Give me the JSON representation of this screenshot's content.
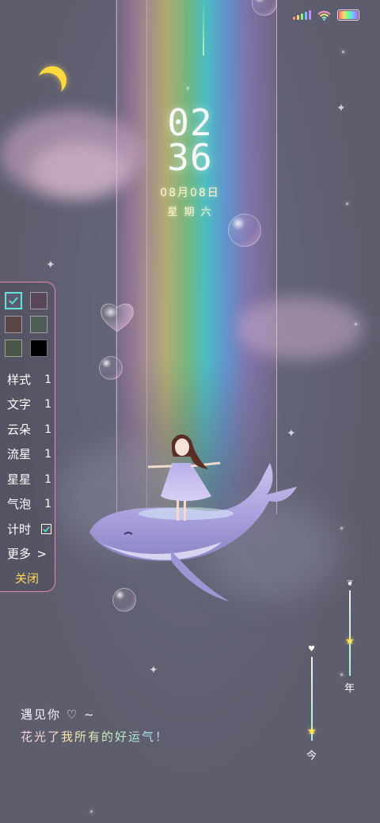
{
  "status": {
    "signal_icon": "signal-icon",
    "wifi_icon": "wifi-icon",
    "battery_icon": "battery-icon"
  },
  "clock": {
    "hour": "02",
    "minute": "36"
  },
  "date": {
    "date": "08月08日",
    "weekday": "星 期 六"
  },
  "panel": {
    "swatches": [
      {
        "color": "#5b5b6b",
        "selected": true
      },
      {
        "color": "#5a4858",
        "selected": false
      },
      {
        "color": "#5a4646",
        "selected": false
      },
      {
        "color": "#4e5c56",
        "selected": false
      },
      {
        "color": "#4c5648",
        "selected": false
      },
      {
        "color": "#000000",
        "selected": false
      }
    ],
    "options": [
      {
        "label": "样式",
        "value": "1"
      },
      {
        "label": "文字",
        "value": "1"
      },
      {
        "label": "云朵",
        "value": "1"
      },
      {
        "label": "流星",
        "value": "1"
      },
      {
        "label": "星星",
        "value": "1"
      },
      {
        "label": "气泡",
        "value": "1"
      }
    ],
    "timer_label": "计时",
    "more_label": "更多",
    "more_arrow": ">",
    "close_label": "关闭"
  },
  "quote": {
    "line1": "遇见你 ♡ ~",
    "line2": "花光了我所有的好运气！"
  },
  "progress": {
    "year": {
      "label": "年",
      "fraction": 0.6
    },
    "today": {
      "label": "今",
      "fraction": 0.9
    }
  },
  "colors": {
    "accent": "#e68ab8",
    "check": "#5fe3d8",
    "moon": "#ffd93c",
    "close": "#ffd95a"
  }
}
